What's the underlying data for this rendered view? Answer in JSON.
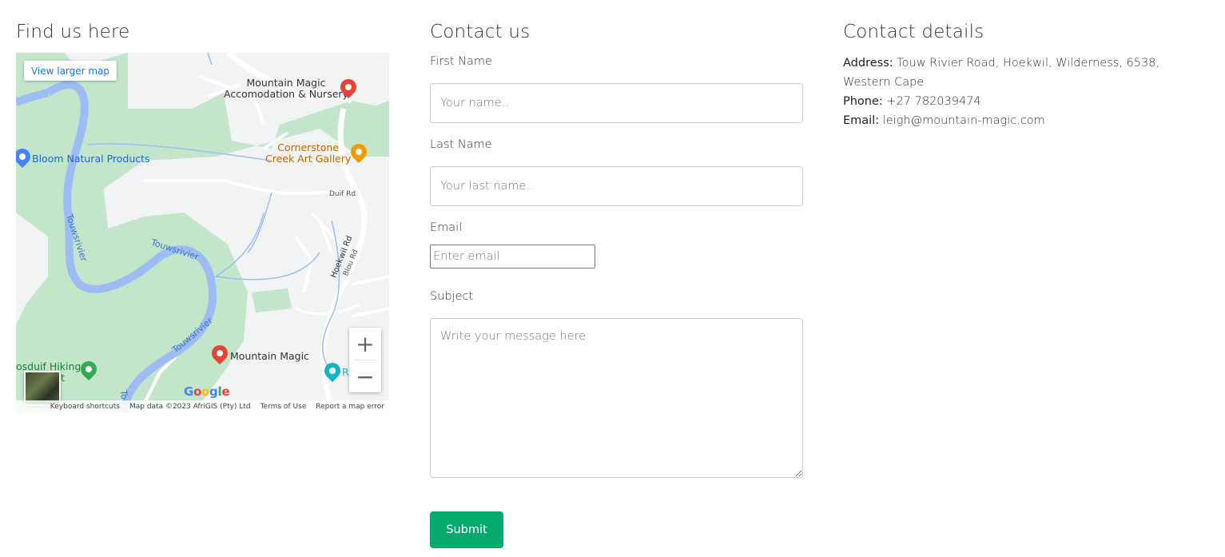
{
  "map_section": {
    "heading": "Find us here",
    "view_larger_label": "View larger map",
    "places": {
      "mountain_magic_nursery_line1": "Mountain Magic",
      "mountain_magic_nursery_line2": "Accomodation & Nursery",
      "cornerstone_line1": "Cornerstone",
      "cornerstone_line2": "Creek Art Gallery",
      "bloom": "Bloom Natural Products",
      "mountain_magic": "Mountain Magic",
      "hiking_line1": "osduif Hiking",
      "hiking_line2": "Point",
      "re": "Re"
    },
    "roads": {
      "duif": "Duif Rd",
      "hoekwil": "Hoekwil Rd",
      "blou": "Blou Rd"
    },
    "rivers": [
      "Touwsrivier",
      "Touwsrivier",
      "Touwsrivier",
      "Tou"
    ],
    "zoom_in": "+",
    "zoom_out": "−",
    "logo": "Google",
    "footer": {
      "shortcuts": "Keyboard shortcuts",
      "data": "Map data ©2023 AfriGIS (Pty) Ltd",
      "terms": "Terms of Use",
      "report": "Report a map error"
    },
    "colors": {
      "green": "#c3e6cb",
      "river": "#9dbcf3",
      "road": "#ffffff",
      "pin_red": "#ea4335",
      "pin_orange": "#f29900",
      "pin_blue": "#4285f4",
      "pin_green": "#34a853",
      "pin_teal": "#12b5cb"
    }
  },
  "form_section": {
    "heading": "Contact us",
    "first_name": {
      "label": "First Name",
      "placeholder": "Your name.."
    },
    "last_name": {
      "label": "Last Name",
      "placeholder": "Your last name.."
    },
    "email": {
      "label": "Email",
      "placeholder": "Enter email"
    },
    "subject": {
      "label": "Subject",
      "placeholder": "Write your message here"
    },
    "submit_label": "Submit",
    "submit_color": "#04aa6d"
  },
  "details_section": {
    "heading": "Contact details",
    "address_label": "Address:",
    "address_value": "Touw Rivier Road, Hoekwil, Wilderness, 6538, Western Cape",
    "phone_label": "Phone:",
    "phone_value": "+27 782039474",
    "email_label": "Email:",
    "email_value": "leigh@mountain-magic.com"
  }
}
